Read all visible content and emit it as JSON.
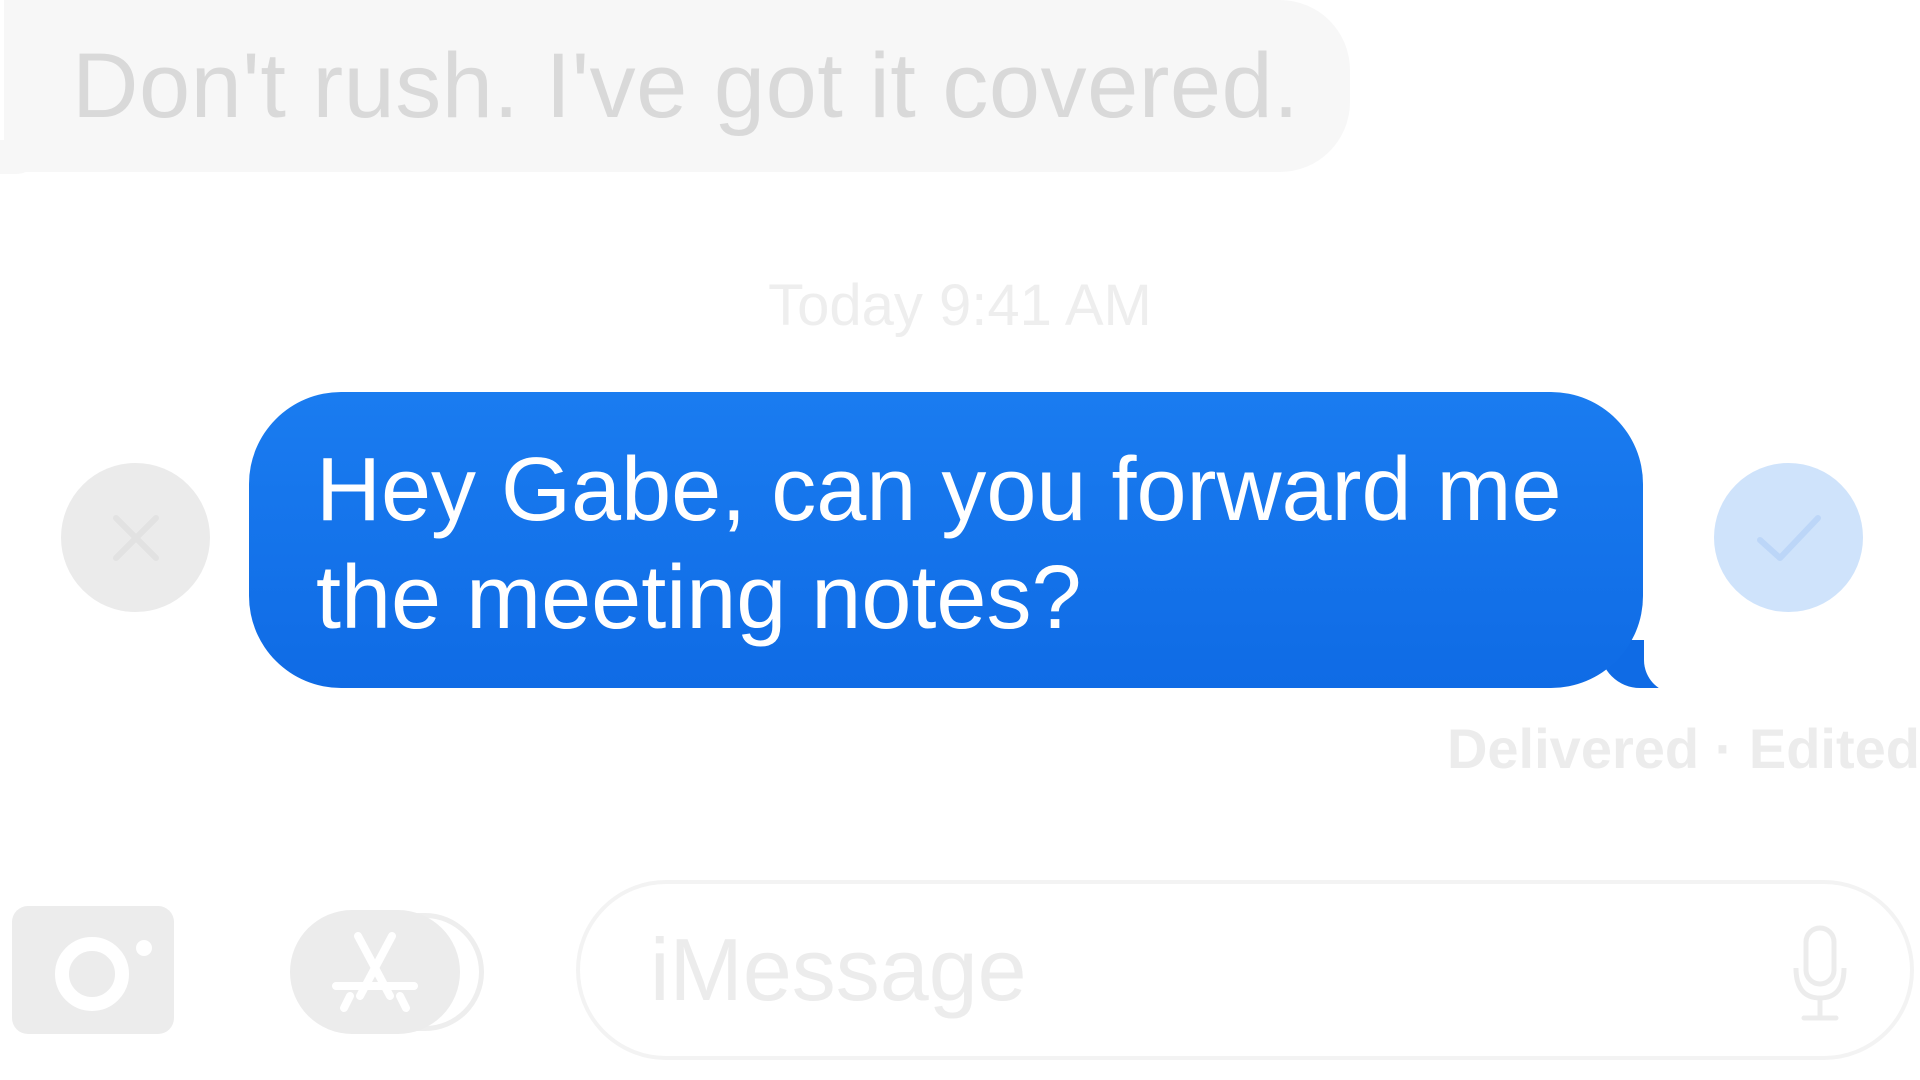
{
  "conversation": {
    "incoming_message": "Don't rush. I've got it covered.",
    "timestamp": "Today 9:41 AM",
    "outgoing_message": {
      "line1": "Hey Gabe, can you forward me",
      "line2": "the meeting notes?"
    },
    "delivery_status": "Delivered · Edited"
  },
  "edit_controls": {
    "cancel_icon": "close-icon",
    "confirm_icon": "checkmark-icon"
  },
  "input_bar": {
    "camera_icon": "camera-icon",
    "apps_icon": "app-store-icon",
    "placeholder": "iMessage",
    "mic_icon": "microphone-icon"
  },
  "colors": {
    "outgoing_bubble": "#1a7cf0",
    "confirm_button": "#cfe3fb",
    "incoming_bubble": "#f7f7f7"
  }
}
